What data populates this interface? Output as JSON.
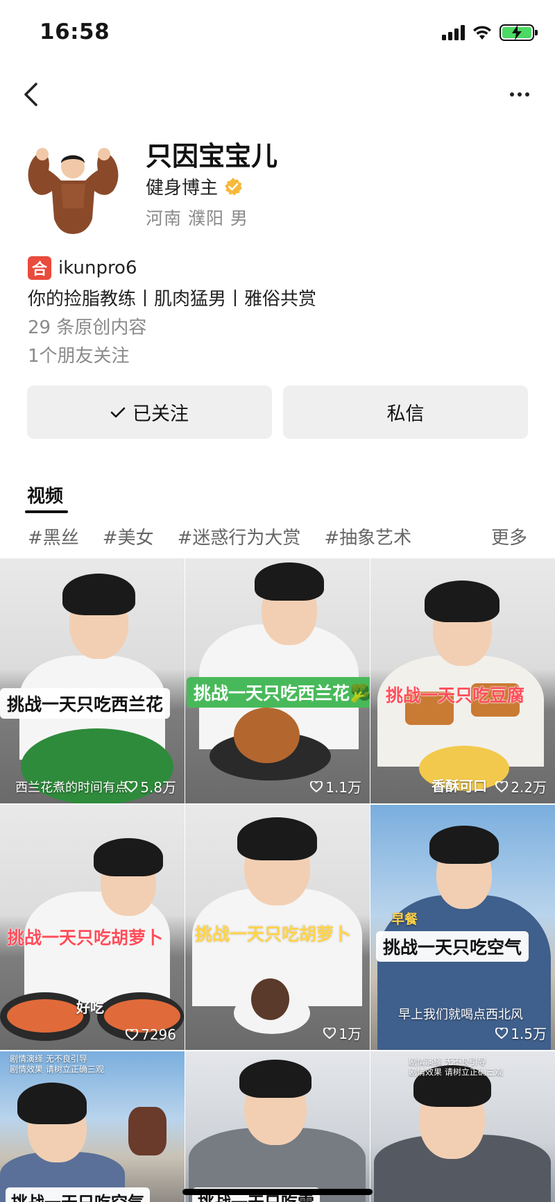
{
  "status_bar": {
    "time": "16:58"
  },
  "profile": {
    "name": "只因宝宝儿",
    "title": "健身博主",
    "location": "河南  濮阳  男",
    "account_badge": "合",
    "account_id": "ikunpro6",
    "bio": "你的捡脂教练丨肌肉猛男丨雅俗共赏",
    "original_count": "29 条原创内容",
    "friends_follow": "1个朋友关注"
  },
  "actions": {
    "follow_label": "已关注",
    "message_label": "私信"
  },
  "tabs": {
    "video_label": "视频"
  },
  "tags": {
    "items": [
      "#黑丝",
      "#美女",
      "#迷惑行为大赏",
      "#抽象艺术"
    ],
    "more_label": "更多"
  },
  "videos": [
    {
      "caption": "挑战一天只吃西兰花",
      "overlay": "西兰花煮的时间有点",
      "likes": "5.8万"
    },
    {
      "caption": "挑战一天只吃西兰花🥦",
      "overlay": "",
      "likes": "1.1万"
    },
    {
      "caption": "挑战一天只吃豆腐",
      "overlay": "香酥可口",
      "likes": "2.2万"
    },
    {
      "caption": "挑战一天只吃胡萝卜",
      "overlay": "好吃",
      "likes": "7296"
    },
    {
      "caption": "挑战一天只吃胡萝卜",
      "overlay": "",
      "likes": "1万"
    },
    {
      "caption": "挑战一天只吃空气",
      "tag": "早餐",
      "overlay": "早上我们就喝点西北风",
      "likes": "1.5万"
    },
    {
      "caption": "挑战一天只吃空气",
      "overlay_top": "剧情演绎 无不良引导\n剧情效果 请树立正确三观"
    },
    {
      "caption": "挑战一天只吃雪"
    },
    {
      "caption": "",
      "overlay_top": "剧情演绎 无不良引导\n剧情效果 请树立正确三观"
    }
  ],
  "colors": {
    "verified": "#f6b93b",
    "account_badge": "#e94b3c",
    "caption_green": "#48b95a",
    "caption_red": "#ff4d5a",
    "caption_yellow": "#ffd34a",
    "battery": "#4cd964"
  }
}
